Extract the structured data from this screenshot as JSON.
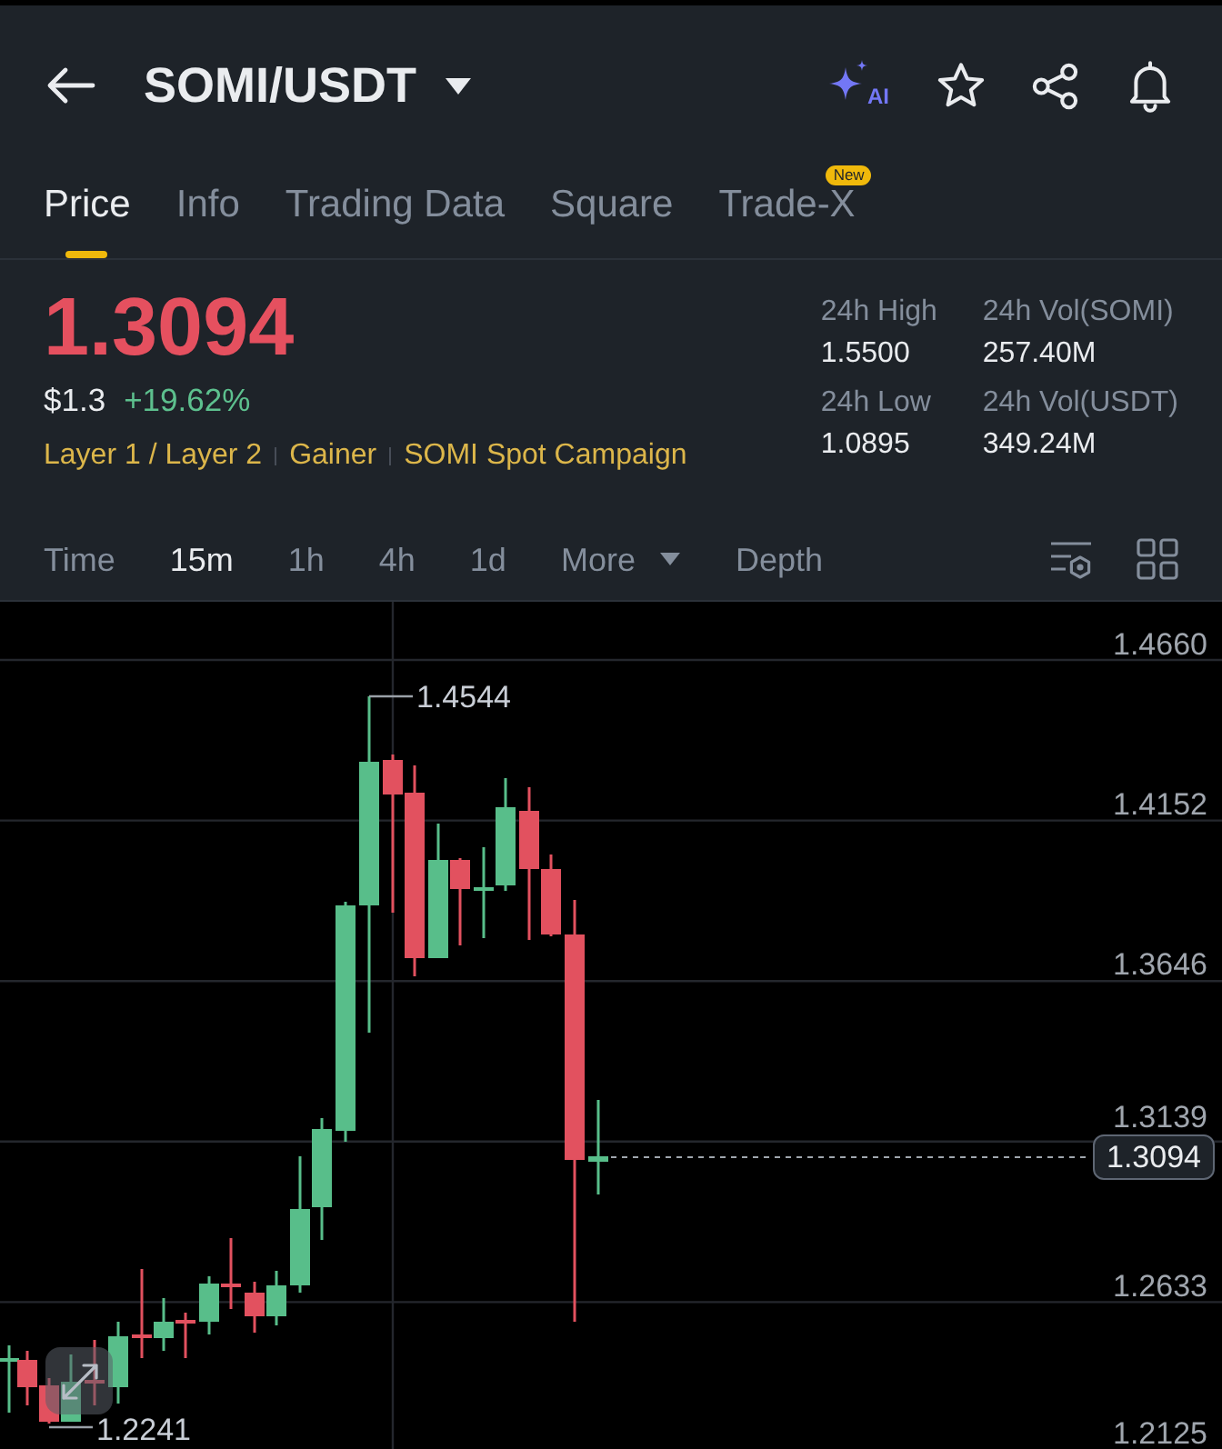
{
  "header": {
    "title": "SOMI/USDT",
    "ai_label": "AI"
  },
  "tabs": [
    {
      "label": "Price",
      "selected": true
    },
    {
      "label": "Info",
      "selected": false
    },
    {
      "label": "Trading Data",
      "selected": false
    },
    {
      "label": "Square",
      "selected": false
    },
    {
      "label": "Trade-X",
      "selected": false,
      "badge": "New"
    }
  ],
  "price": {
    "last": "1.3094",
    "last_rising": false,
    "fiat": "$1.3",
    "change": "+19.62%",
    "change_rising": true
  },
  "tags": [
    "Layer 1 / Layer 2",
    "Gainer",
    "SOMI Spot Campaign"
  ],
  "stats": [
    {
      "label": "24h High",
      "value": "1.5500"
    },
    {
      "label": "24h Vol(SOMI)",
      "value": "257.40M"
    },
    {
      "label": "24h Low",
      "value": "1.0895"
    },
    {
      "label": "24h Vol(USDT)",
      "value": "349.24M"
    }
  ],
  "intervals": [
    {
      "label": "Time",
      "kind": "option",
      "selected": false
    },
    {
      "label": "15m",
      "kind": "option",
      "selected": true
    },
    {
      "label": "1h",
      "kind": "option",
      "selected": false
    },
    {
      "label": "4h",
      "kind": "option",
      "selected": false
    },
    {
      "label": "1d",
      "kind": "option",
      "selected": false
    },
    {
      "label": "More",
      "kind": "menu",
      "selected": false
    },
    {
      "label": "Depth",
      "kind": "option",
      "selected": false
    }
  ],
  "chart": {
    "price_axis": [
      "1.4660",
      "1.4152",
      "1.3646",
      "1.3139",
      "1.2633",
      "1.2125"
    ],
    "high_label": "1.4544",
    "low_label": "1.2241",
    "last_price": "1.3094"
  }
}
